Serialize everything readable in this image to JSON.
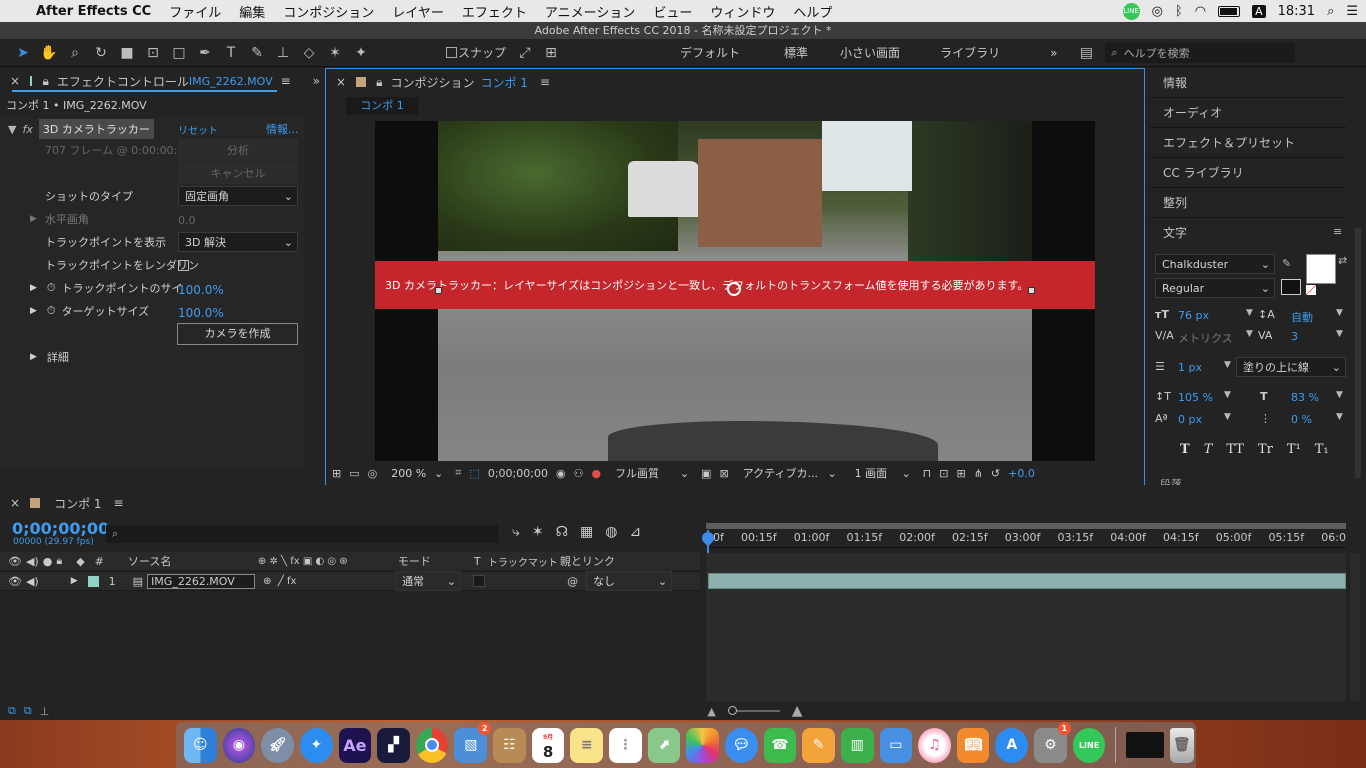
{
  "menubar": {
    "apple": "",
    "app": "After Effects CC",
    "items": [
      "ファイル",
      "編集",
      "コンポジション",
      "レイヤー",
      "エフェクト",
      "アニメーション",
      "ビュー",
      "ウィンドウ",
      "ヘルプ"
    ],
    "clock": "18:31",
    "input_mode": "A"
  },
  "window_title": "Adobe After Effects CC 2018 - 名称未設定プロジェクト *",
  "toolbar": {
    "snap_label": "スナップ",
    "workspaces": [
      "デフォルト",
      "標準",
      "小さい画面",
      "ライブラリ"
    ],
    "search_placeholder": "ヘルプを検索",
    "more": "»"
  },
  "effect_controls": {
    "tab": "エフェクトコントロール",
    "tab_file": "IMG_2262.MOV",
    "subtitle": "コンポ 1 • IMG_2262.MOV",
    "effect_name": "3D カメラトラッカー",
    "reset": "リセット",
    "info": "情報...",
    "frames_text": "707 フレーム @ 0:00:00:",
    "analyze": "分析",
    "cancel": "キャンセル",
    "shot_type_label": "ショットのタイプ",
    "shot_type_value": "固定画角",
    "hfov_label": "水平画角",
    "hfov_value": "0.0",
    "show_track_label": "トラックポイントを表示",
    "show_track_value": "3D 解決",
    "render_track_label": "トラックポイントをレンダリン",
    "track_size_label": "トラックポイントのサイ",
    "track_size_value": "100.0%",
    "target_size_label": "ターゲットサイズ",
    "target_size_value": "100.0%",
    "create_camera": "カメラを作成",
    "details": "詳細"
  },
  "composition": {
    "tab_prefix": "コンポジション",
    "tab_name": "コンポ 1",
    "sub_tab": "コンポ 1",
    "warning": "3D カメラトラッカー：レイヤーサイズはコンポジションと一致し、デフォルトのトランスフォーム値を使用する必要があります。",
    "zoom": "200 %",
    "timecode": "0;00;00;00",
    "quality": "フル画質",
    "camera": "アクティブカ...",
    "views": "1 画面",
    "exposure": "+0.0"
  },
  "right_panels": {
    "items": [
      "情報",
      "オーディオ",
      "エフェクト＆プリセット",
      "CC ライブラリ",
      "整列"
    ],
    "text_title": "文字",
    "font": "Chalkduster",
    "style": "Regular",
    "size": "76 px",
    "leading": "自動",
    "kerning": "メトリクス",
    "tracking": "3",
    "stroke": "1 px",
    "stroke_mode": "塗りの上に線",
    "vscale": "105 %",
    "hscale": "83 %",
    "baseline": "0 px",
    "tsume": "0 %",
    "styles_row": [
      "T",
      "T",
      "TT",
      "Tr",
      "T¹",
      "T₁"
    ],
    "next_section": "段落"
  },
  "timeline": {
    "tab": "コンポ 1",
    "timecode": "0;00;00;00",
    "fps": "00000 (29.97 fps)",
    "search_placeholder": "",
    "ruler": [
      "00f",
      "00:15f",
      "01:00f",
      "01:15f",
      "02:00f",
      "02:15f",
      "03:00f",
      "03:15f",
      "04:00f",
      "04:15f",
      "05:00f",
      "05:15f",
      "06:0"
    ],
    "columns": {
      "num": "#",
      "source": "ソース名",
      "mode": "モード",
      "t": "T",
      "trackmatte": "トラックマット",
      "parent": "親とリンク"
    },
    "layer": {
      "num": "1",
      "name": "IMG_2262.MOV",
      "mode": "通常",
      "parent": "なし"
    }
  },
  "dock": {
    "calendar_day": "8",
    "calendar_month": "9月",
    "badge_photos": "2",
    "badge_prefs": "1"
  },
  "colors": {
    "accent": "#3d9cf0",
    "warning_bg": "#c4262b",
    "layer_bar": "#8fb1ad",
    "label_color": "#8fd3c6"
  }
}
